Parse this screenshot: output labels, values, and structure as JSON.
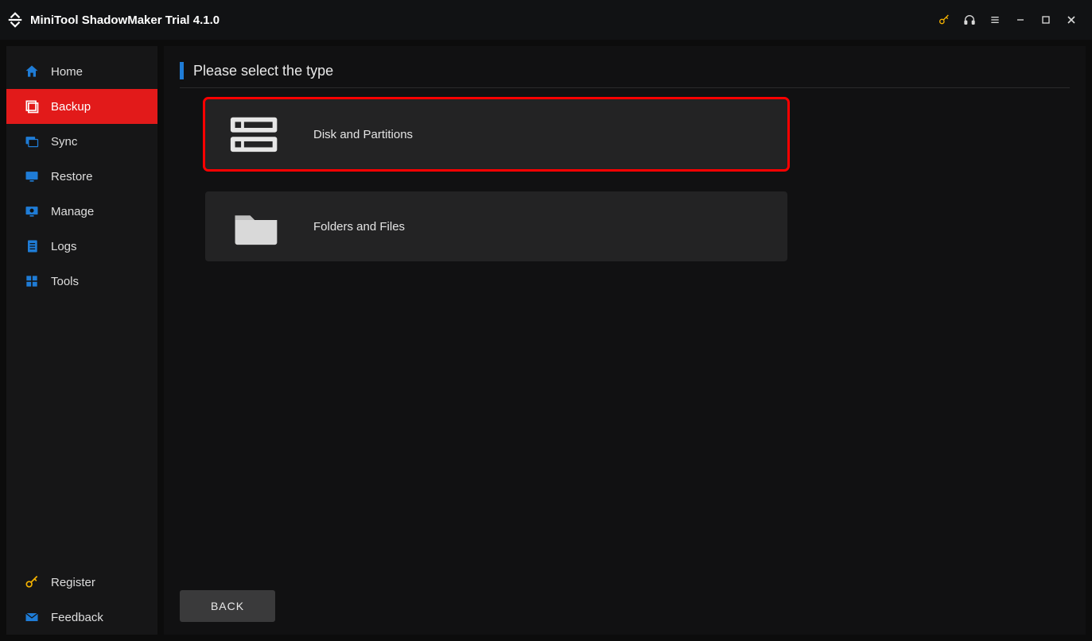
{
  "titlebar": {
    "app_title": "MiniTool ShadowMaker Trial 4.1.0"
  },
  "sidebar": {
    "items": [
      {
        "label": "Home",
        "icon": "home"
      },
      {
        "label": "Backup",
        "icon": "backup",
        "active": true
      },
      {
        "label": "Sync",
        "icon": "sync"
      },
      {
        "label": "Restore",
        "icon": "restore"
      },
      {
        "label": "Manage",
        "icon": "manage"
      },
      {
        "label": "Logs",
        "icon": "logs"
      },
      {
        "label": "Tools",
        "icon": "tools"
      }
    ],
    "bottom": [
      {
        "label": "Register",
        "icon": "key"
      },
      {
        "label": "Feedback",
        "icon": "mail"
      }
    ]
  },
  "main": {
    "heading": "Please select the type",
    "options": [
      {
        "label": "Disk and Partitions",
        "selected": true
      },
      {
        "label": "Folders and Files",
        "selected": false
      }
    ],
    "back_label": "BACK"
  }
}
